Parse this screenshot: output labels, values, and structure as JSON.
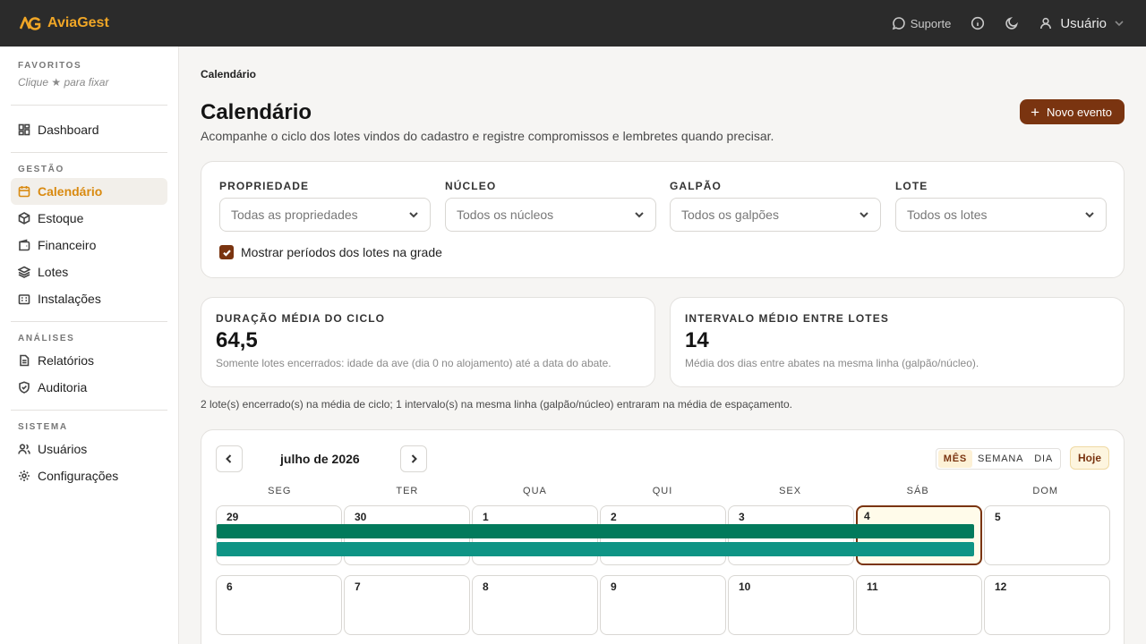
{
  "app": {
    "brand": "AviaGest",
    "top_actions": {
      "support": "Suporte",
      "user": "Usuário"
    }
  },
  "sidebar": {
    "favorites_title": "FAVORITOS",
    "favorites_hint": "Clique ★ para fixar",
    "dashboard": "Dashboard",
    "sections": [
      {
        "title": "GESTÃO",
        "items": [
          "Calendário",
          "Estoque",
          "Financeiro",
          "Lotes",
          "Instalações"
        ]
      },
      {
        "title": "ANÁLISES",
        "items": [
          "Relatórios",
          "Auditoria"
        ]
      },
      {
        "title": "SISTEMA",
        "items": [
          "Usuários",
          "Configurações"
        ]
      }
    ]
  },
  "page": {
    "breadcrumb": "Calendário",
    "title": "Calendário",
    "subtitle": "Acompanhe o ciclo dos lotes vindos do cadastro e registre compromissos e lembretes quando precisar.",
    "new_event_label": "Novo evento"
  },
  "filters": {
    "items": [
      {
        "label": "PROPRIEDADE",
        "placeholder": "Todas as propriedades"
      },
      {
        "label": "NÚCLEO",
        "placeholder": "Todos os núcleos"
      },
      {
        "label": "GALPÃO",
        "placeholder": "Todos os galpões"
      },
      {
        "label": "LOTE",
        "placeholder": "Todos os lotes"
      }
    ],
    "show_periods_label": "Mostrar períodos dos lotes na grade",
    "show_periods_checked": true
  },
  "stats": [
    {
      "label": "DURAÇÃO MÉDIA DO CICLO",
      "value": "64,5",
      "note": "Somente lotes encerrados: idade da ave (dia 0 no alojamento) até a data do abate."
    },
    {
      "label": "INTERVALO MÉDIO ENTRE LOTES",
      "value": "14",
      "note": "Média dos dias entre abates na mesma linha (galpão/núcleo)."
    }
  ],
  "summary_note": "2 lote(s) encerrado(s) na média de ciclo; 1 intervalo(s) na mesma linha (galpão/núcleo) entraram na média de espaçamento.",
  "calendar": {
    "month_label": "julho de 2026",
    "views": [
      "MÊS",
      "SEMANA",
      "DIA"
    ],
    "active_view": "MÊS",
    "today_label": "Hoje",
    "weekdays": [
      "SEG",
      "TER",
      "QUA",
      "QUI",
      "SEX",
      "SÁB",
      "DOM"
    ],
    "weeks": [
      [
        "29",
        "30",
        "1",
        "2",
        "3",
        "4",
        "5"
      ],
      [
        "6",
        "7",
        "8",
        "9",
        "10",
        "11",
        "12"
      ]
    ],
    "today": "4",
    "batch_colors": [
      "#027a5c",
      "#0f9485"
    ]
  }
}
